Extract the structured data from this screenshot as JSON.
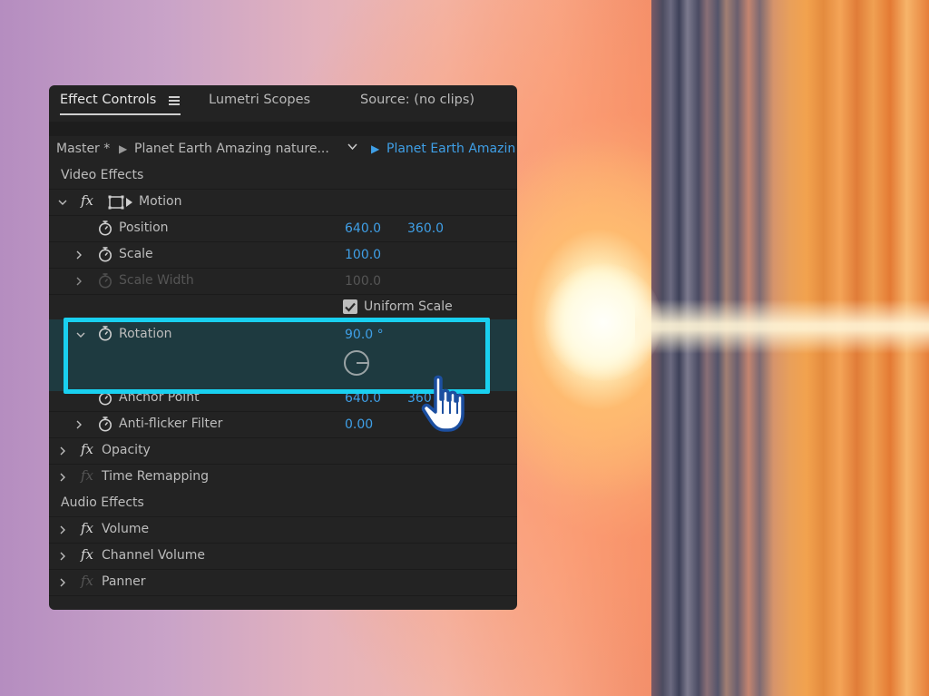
{
  "tabs": [
    {
      "label": "Effect Controls",
      "active": true
    },
    {
      "label": "Lumetri Scopes",
      "active": false
    },
    {
      "label": "Source: (no clips)",
      "active": false
    }
  ],
  "master": {
    "prefix": "Master *",
    "clip_name": "Planet Earth  Amazing nature...",
    "sequence_clip": "Planet Earth  Amazin"
  },
  "sections": {
    "video": "Video Effects",
    "audio": "Audio Effects"
  },
  "motion": {
    "label": "Motion",
    "position": {
      "label": "Position",
      "x": "640.0",
      "y": "360.0"
    },
    "scale": {
      "label": "Scale",
      "value": "100.0"
    },
    "scale_width": {
      "label": "Scale Width",
      "value": "100.0"
    },
    "uniform_scale": {
      "label": "Uniform Scale",
      "checked": true
    },
    "rotation": {
      "label": "Rotation",
      "value": "90.0 °"
    },
    "anchor_point": {
      "label": "Anchor Point",
      "x": "640.0",
      "y": "360"
    },
    "anti_flicker": {
      "label": "Anti-flicker Filter",
      "value": "0.00"
    }
  },
  "video_effects": [
    {
      "label": "Opacity"
    },
    {
      "label": "Time Remapping"
    }
  ],
  "audio_effects": [
    {
      "label": "Volume"
    },
    {
      "label": "Channel Volume"
    },
    {
      "label": "Panner"
    }
  ],
  "colors": {
    "accent_blue": "#3f9fe6",
    "highlight": "#19d0f0",
    "panel_bg": "#232323"
  },
  "icons": [
    "menu-icon",
    "chevron-down-icon",
    "chevron-right-icon",
    "fx-icon",
    "transform-icon",
    "stopwatch-icon",
    "checkbox-icon",
    "rotation-dial-icon",
    "hand-pointer-icon"
  ]
}
